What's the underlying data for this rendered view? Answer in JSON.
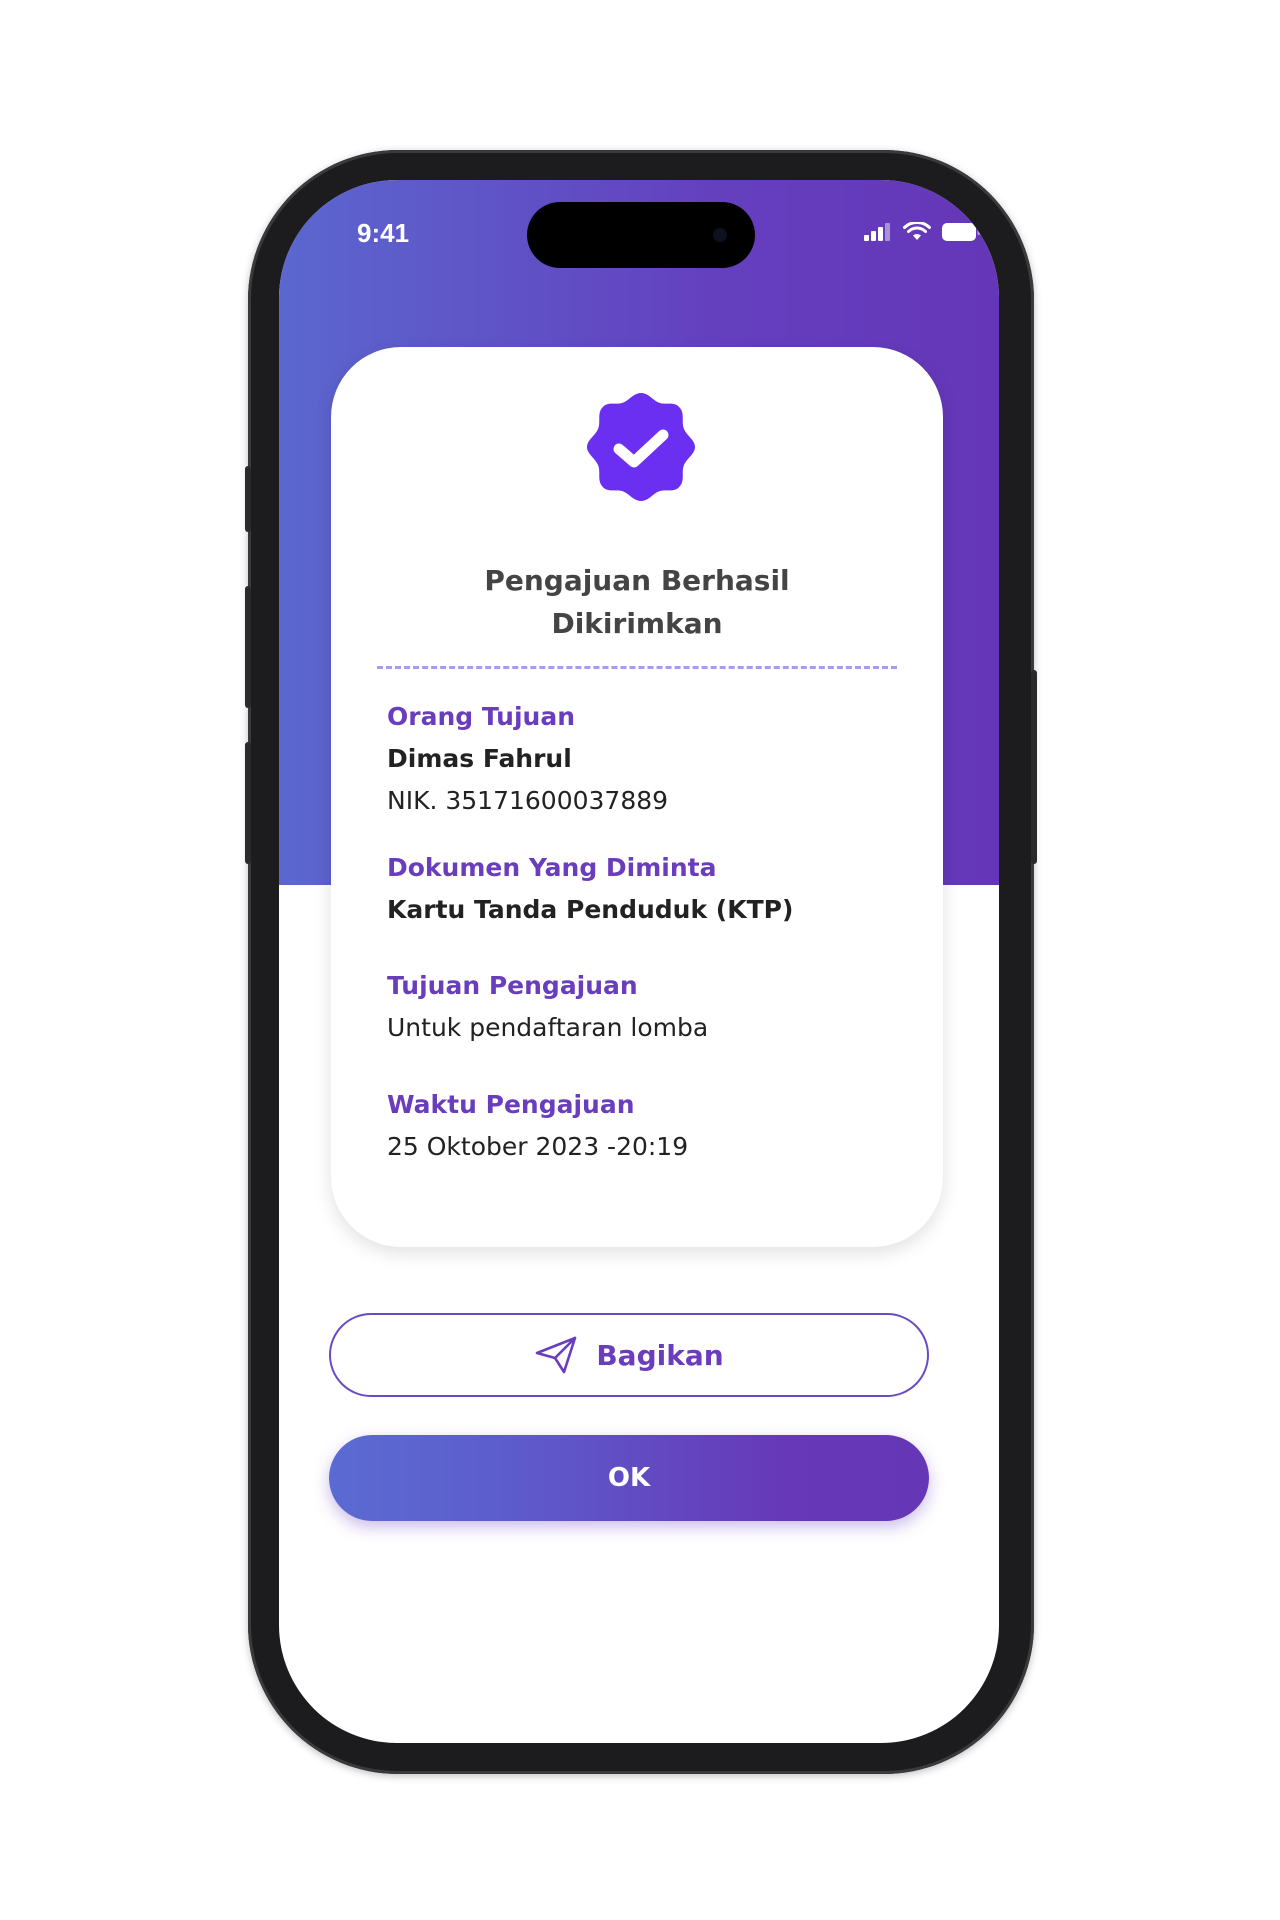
{
  "status_bar": {
    "time": "9:41"
  },
  "card": {
    "title_line1": "Pengajuan Berhasil",
    "title_line2": "Dikirimkan",
    "orang_tujuan": {
      "label": "Orang Tujuan",
      "name": "Dimas Fahrul",
      "nik": "NIK. 35171600037889"
    },
    "dokumen": {
      "label": "Dokumen Yang Diminta",
      "value": "Kartu Tanda Penduduk (KTP)"
    },
    "tujuan": {
      "label": "Tujuan Pengajuan",
      "value": "Untuk pendaftaran lomba"
    },
    "waktu": {
      "label": "Waktu Pengajuan",
      "value": "25 Oktober 2023 -20:19"
    }
  },
  "buttons": {
    "share_label": "Bagikan",
    "ok_label": "OK"
  },
  "colors": {
    "accent": "#6a3dbd",
    "gradient_start": "#5b67cf",
    "gradient_end": "#6536b8"
  },
  "icons": {
    "badge": "verified-badge-icon",
    "share": "paper-plane-icon"
  }
}
